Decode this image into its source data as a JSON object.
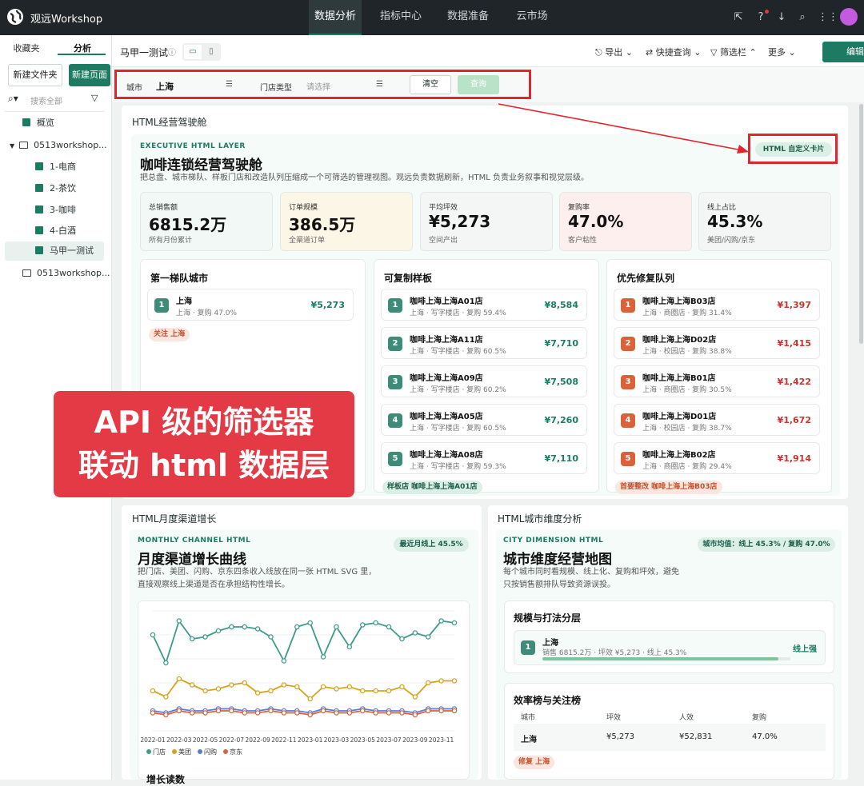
{
  "app": {
    "name": "观远Workshop"
  },
  "nav": [
    "数据分析",
    "指标中心",
    "数据准备",
    "云市场"
  ],
  "sidebar": {
    "tabs": [
      "收藏夹",
      "分析"
    ],
    "buttons": {
      "new_folder": "新建文件夹",
      "new_page": "新建页面"
    },
    "search_placeholder": "搜索全部",
    "items": [
      {
        "label": "概览"
      },
      {
        "label": "0513workshop..."
      },
      {
        "label": "1-电商"
      },
      {
        "label": "2-茶饮"
      },
      {
        "label": "3-咖啡"
      },
      {
        "label": "4-白酒"
      },
      {
        "label": "马甲一测试"
      },
      {
        "label": "0513workshop..."
      }
    ]
  },
  "page": {
    "title": "马甲一测试",
    "actions": {
      "export": "导出",
      "quick_query": "快捷查询",
      "filter_bar": "筛选栏",
      "more": "更多",
      "edit": "编辑"
    }
  },
  "filters": {
    "city_label": "城市",
    "city_value": "上海",
    "store_type_label": "门店类型",
    "store_type_placeholder": "请选择",
    "clear": "清空",
    "query": "查询"
  },
  "cockpit": {
    "card_title": "HTML经营驾驶舱",
    "eyebrow": "EXECUTIVE HTML LAYER",
    "title": "咖啡连锁经营驾驶舱",
    "subtitle": "把总盘、城市梯队、样板门店和改造队列压缩成一个可筛选的管理视图。观远负责数据刷新，HTML 负责业务叙事和视觉层级。",
    "badge": "HTML 自定义卡片",
    "kpis": [
      {
        "label": "总销售额",
        "value": "6815.2万",
        "sub": "所有月份累计",
        "bg": "#f1f8f5"
      },
      {
        "label": "订单规模",
        "value": "386.5万",
        "sub": "全渠道订单",
        "bg": "#fbf6e6"
      },
      {
        "label": "平均坪效",
        "value": "¥5,273",
        "sub": "空间产出",
        "bg": "#f3f6f5"
      },
      {
        "label": "复购率",
        "value": "47.0%",
        "sub": "客户粘性",
        "bg": "#fcefed"
      },
      {
        "label": "线上占比",
        "value": "45.3%",
        "sub": "美团/闪购/京东",
        "bg": "#f3f6f5"
      }
    ],
    "tier": {
      "title": "第一梯队城市",
      "rows": [
        {
          "rank": "1",
          "name": "上海",
          "sub": "上海 · 复购 47.0%",
          "value": "¥5,273"
        }
      ],
      "tag": "关注 上海"
    },
    "template": {
      "title": "可复制样板",
      "rows": [
        {
          "rank": "1",
          "name": "咖啡上海上海A01店",
          "sub": "上海 · 写字楼店 · 复购 59.4%",
          "value": "¥8,584"
        },
        {
          "rank": "2",
          "name": "咖啡上海上海A11店",
          "sub": "上海 · 写字楼店 · 复购 60.5%",
          "value": "¥7,710"
        },
        {
          "rank": "3",
          "name": "咖啡上海上海A09店",
          "sub": "上海 · 写字楼店 · 复购 60.2%",
          "value": "¥7,508"
        },
        {
          "rank": "4",
          "name": "咖啡上海上海A05店",
          "sub": "上海 · 写字楼店 · 复购 60.5%",
          "value": "¥7,260"
        },
        {
          "rank": "5",
          "name": "咖啡上海上海A08店",
          "sub": "上海 · 写字楼店 · 复购 59.3%",
          "value": "¥7,110"
        }
      ],
      "tag": "样板店 咖啡上海上海A01店"
    },
    "repair": {
      "title": "优先修复队列",
      "rows": [
        {
          "rank": "1",
          "name": "咖啡上海上海B03店",
          "sub": "上海 · 商圈店 · 复购 31.4%",
          "value": "¥1,397"
        },
        {
          "rank": "2",
          "name": "咖啡上海上海D02店",
          "sub": "上海 · 校园店 · 复购 38.8%",
          "value": "¥1,415"
        },
        {
          "rank": "3",
          "name": "咖啡上海上海B01店",
          "sub": "上海 · 商圈店 · 复购 30.5%",
          "value": "¥1,422"
        },
        {
          "rank": "4",
          "name": "咖啡上海上海D01店",
          "sub": "上海 · 校园店 · 复购 38.7%",
          "value": "¥1,672"
        },
        {
          "rank": "5",
          "name": "咖啡上海上海B02店",
          "sub": "上海 · 商圈店 · 复购 29.4%",
          "value": "¥1,914"
        }
      ],
      "tag": "首要整改 咖啡上海上海B03店"
    }
  },
  "overlay": {
    "line1": "API 级的筛选器",
    "line2": "联动 html 数据层"
  },
  "monthly": {
    "card_title": "HTML月度渠道增长",
    "eyebrow": "MONTHLY CHANNEL HTML",
    "title": "月度渠道增长曲线",
    "subtitle1": "把门店、美团、闪购、京东四条收入线放在同一张 HTML SVG 里，",
    "subtitle2": "直接观察线上渠道是否在承担结构性增长。",
    "badge": "最近月线上 45.5%",
    "section_next": "增长读数"
  },
  "city": {
    "card_title": "HTML城市维度分析",
    "eyebrow": "CITY DIMENSION HTML",
    "title": "城市维度经营地图",
    "subtitle1": "每个城市同时看规模、线上化、复购和坪效，避免",
    "subtitle2": "只按销售额排队导致资源误投。",
    "badge": "城市均值：线上 45.3% / 复购 47.0%",
    "scale": {
      "title": "规模与打法分层",
      "rank": "1",
      "name": "上海",
      "sub": "销售 6815.2万 · 坪效 ¥5,273 · 线上 45.3%",
      "tag": "线上强",
      "progress": 0.95
    },
    "table": {
      "title": "效率榜与关注榜",
      "headers": [
        "城市",
        "坪效",
        "人效",
        "复购"
      ],
      "row": [
        "上海",
        "¥5,273",
        "¥52,831",
        "47.0%"
      ],
      "tag": "修复 上海"
    }
  },
  "colors": {
    "accent": "#1d7b63",
    "danger": "#d9623b",
    "store": "#3e9a8c",
    "meituan": "#d8a21d",
    "shangou": "#5b7bd5",
    "jd": "#d9623b"
  },
  "chart_data": {
    "type": "line",
    "x": [
      "2022-01",
      "2022-02",
      "2022-03",
      "2022-04",
      "2022-05",
      "2022-06",
      "2022-07",
      "2022-08",
      "2022-09",
      "2022-10",
      "2022-11",
      "2022-12",
      "2023-01",
      "2023-02",
      "2023-03",
      "2023-04",
      "2023-05",
      "2023-06",
      "2023-07",
      "2023-08",
      "2023-09",
      "2023-10",
      "2023-11",
      "2023-12"
    ],
    "tick_labels": [
      "2022-01",
      "2022-03",
      "2022-05",
      "2022-07",
      "2022-09",
      "2022-11",
      "2023-01",
      "2023-03",
      "2023-05",
      "2023-07",
      "2023-09",
      "2023-11"
    ],
    "series": [
      {
        "name": "门店",
        "color": "#3e9a8c",
        "values": [
          88,
          74,
          95,
          86,
          87,
          90,
          92,
          92,
          91,
          87,
          75,
          92,
          94,
          77,
          92,
          82,
          93,
          94,
          92,
          86,
          89,
          87,
          95,
          94
        ]
      },
      {
        "name": "美团",
        "color": "#d8a21d",
        "values": [
          60,
          57,
          66,
          63,
          60,
          61,
          63,
          64,
          59,
          60,
          63,
          62,
          56,
          62,
          61,
          62,
          60,
          60,
          60,
          62,
          57,
          64,
          65,
          65
        ]
      },
      {
        "name": "闪购",
        "color": "#5b7bd5",
        "values": [
          50,
          49,
          51,
          50,
          50,
          51,
          51,
          50,
          50,
          51,
          50,
          50,
          49,
          51,
          50,
          50,
          51,
          50,
          50,
          50,
          49,
          51,
          51,
          51
        ]
      },
      {
        "name": "京东",
        "color": "#d9623b",
        "values": [
          49,
          48,
          50,
          49,
          49,
          50,
          50,
          49,
          49,
          50,
          49,
          49,
          48,
          50,
          49,
          49,
          50,
          49,
          49,
          49,
          48,
          50,
          50,
          50
        ]
      }
    ],
    "ylim": [
      40,
      100
    ],
    "grid": true,
    "legend": "bottom-left"
  }
}
